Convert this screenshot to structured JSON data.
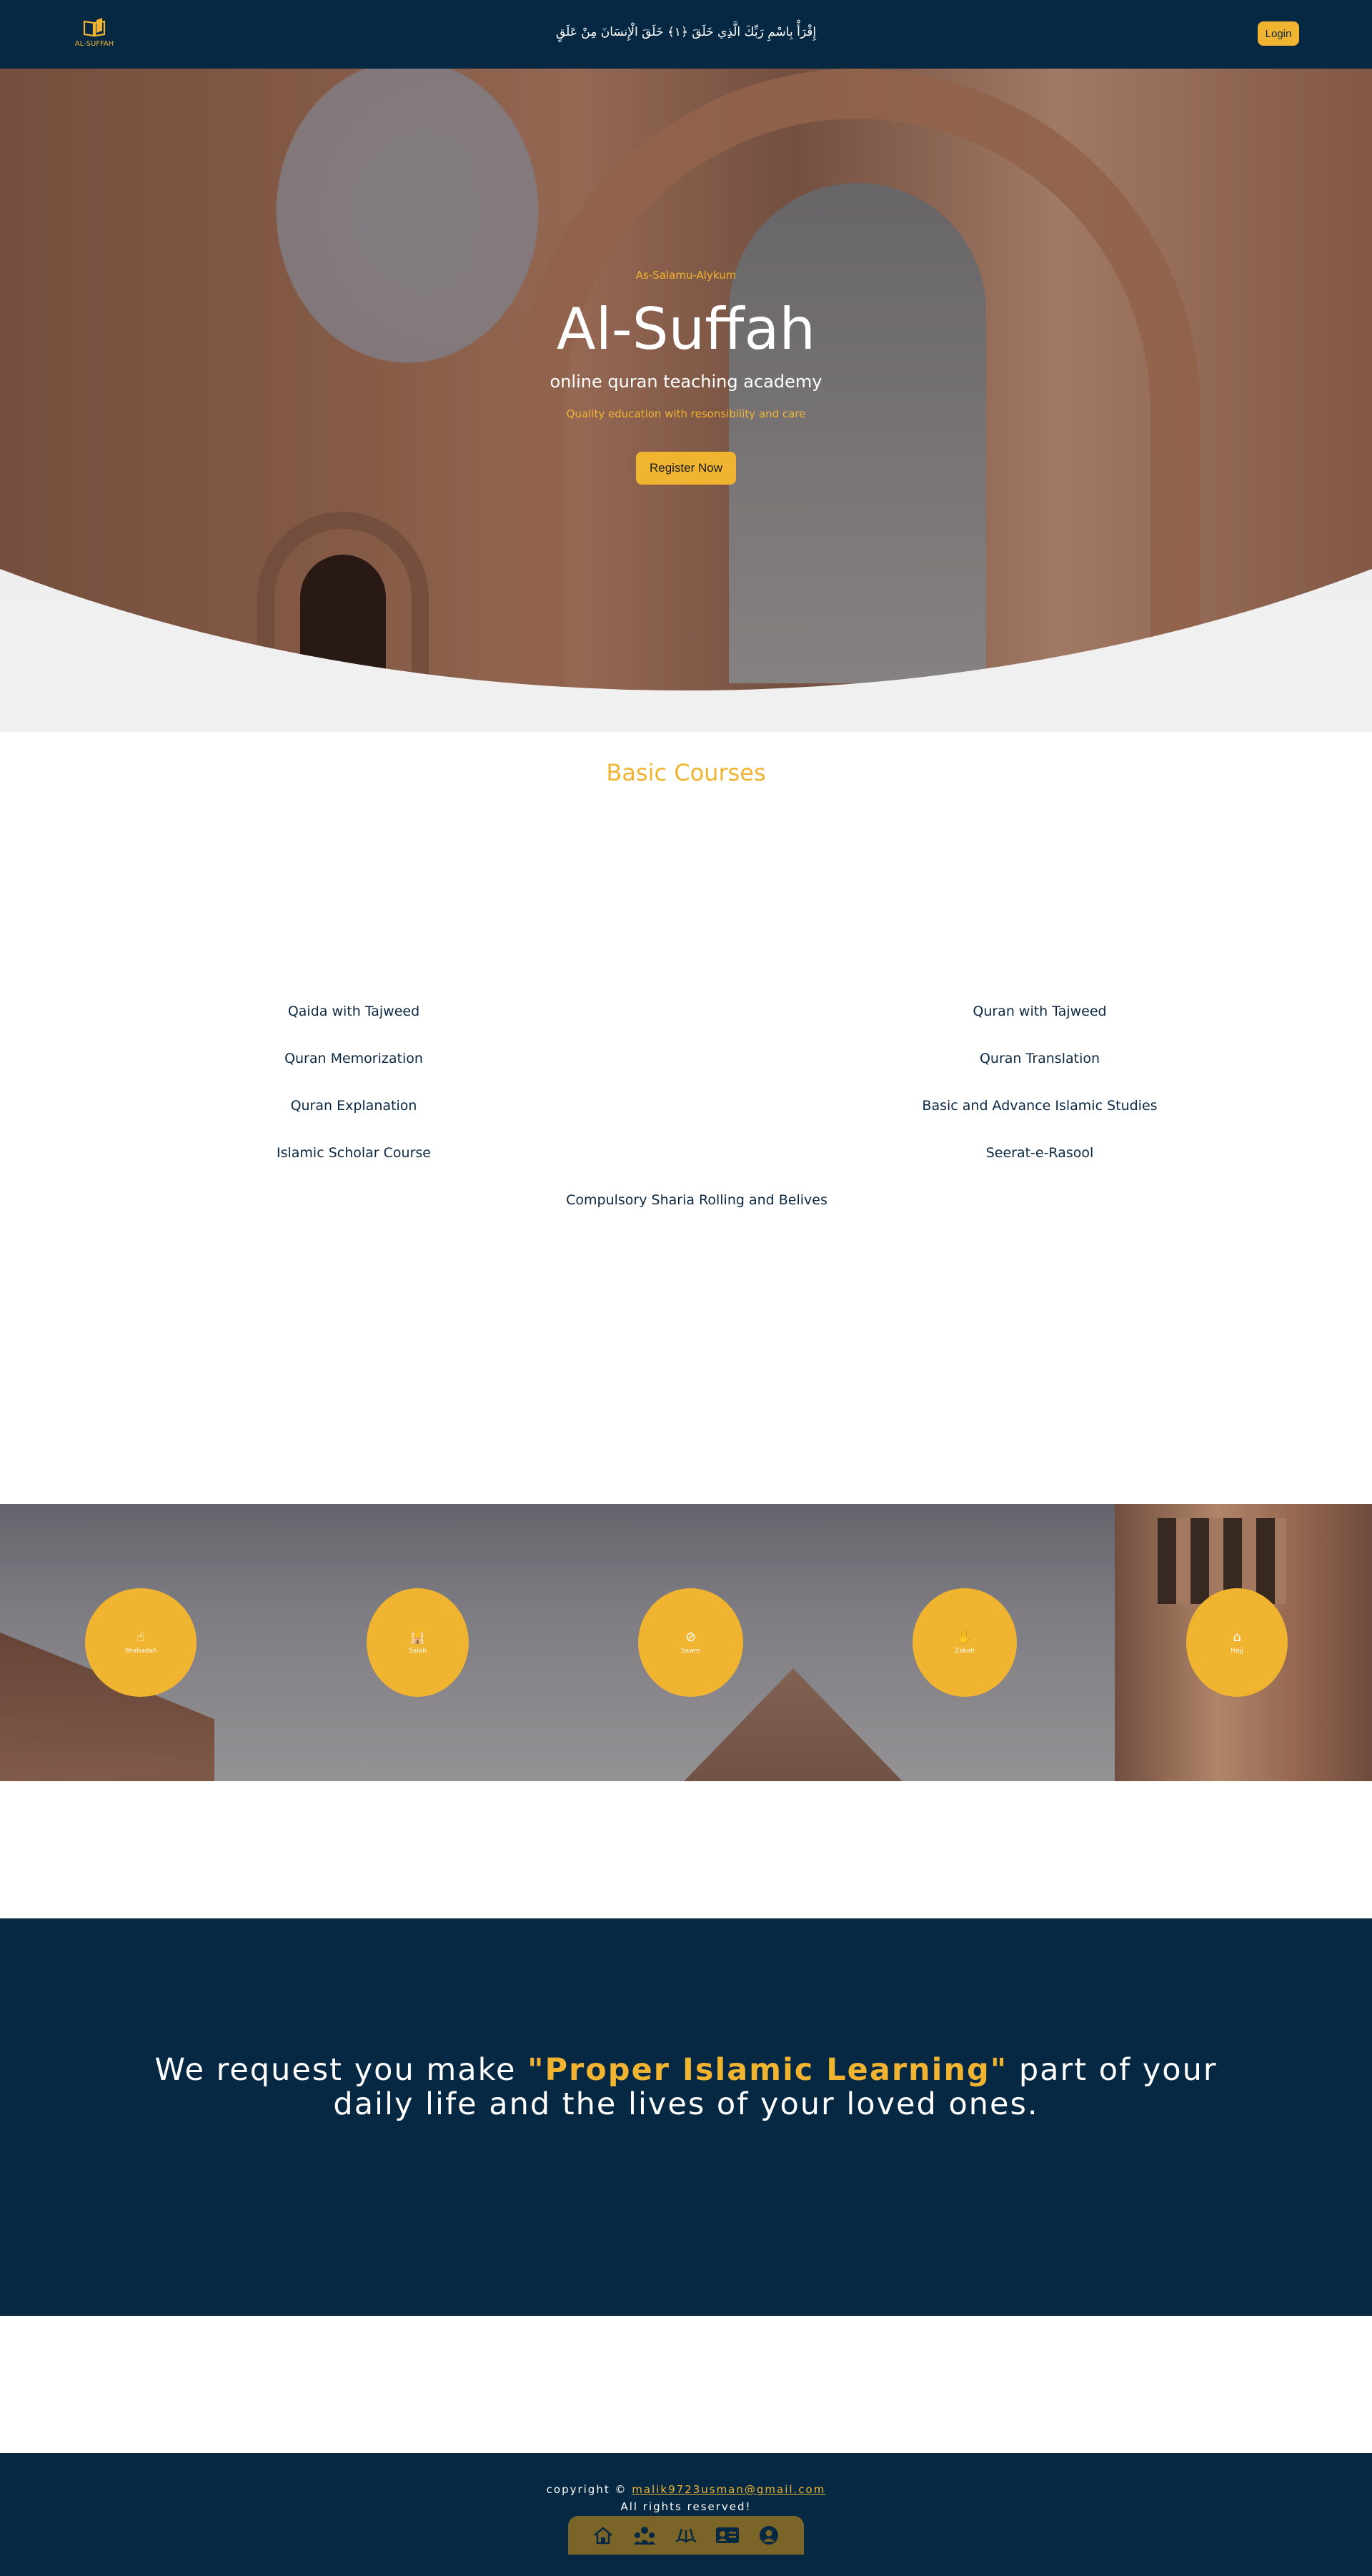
{
  "navbar": {
    "logo_text": "AL-SUFFAH",
    "verse": "إِقْرَأْ بِاسْمِ رَبِّكَ الَّذِي خَلَقَ ﴿١﴾ خَلَقَ الْإِنسَانَ مِنْ عَلَقٍ",
    "login_label": "Login"
  },
  "hero": {
    "greeting": "As-Salamu-Alykum",
    "title": "Al-Suffah",
    "subtitle": "online quran teaching academy",
    "tagline": "Quality education with resonsibility and care",
    "register_label": "Register Now"
  },
  "courses": {
    "title": "Basic Courses",
    "left": [
      "Qaida with Tajweed",
      "Quran Memorization",
      "Quran Explanation",
      "Islamic Scholar Course"
    ],
    "right": [
      "Quran with Tajweed",
      "Quran Translation",
      "Basic and Advance Islamic Studies",
      "Seerat-e-Rasool"
    ],
    "center": "Compulsory Sharia Rolling and Belives"
  },
  "pillars": [
    {
      "label": "Shahadah",
      "icon": "pointing-finger-icon"
    },
    {
      "label": "Salah",
      "icon": "mosque-icon"
    },
    {
      "label": "Sawm",
      "icon": "no-food-icon"
    },
    {
      "label": "Zakah",
      "icon": "hand-giving-icon"
    },
    {
      "label": "Hajj",
      "icon": "kaaba-icon"
    }
  ],
  "request": {
    "before": "We request you make ",
    "highlight": "\"Proper Islamic Learning\"",
    "after": " part of your daily life and the lives of your loved ones."
  },
  "footer": {
    "copyright_prefix": "copyright © ",
    "email": "malik9723usman@gmail.com",
    "rights": "All rights reserved!",
    "nav_icons": [
      "home-icon",
      "people-icon",
      "book-icon",
      "contact-card-icon",
      "user-icon"
    ]
  },
  "colors": {
    "navy": "#062843",
    "gold": "#f0b431"
  }
}
